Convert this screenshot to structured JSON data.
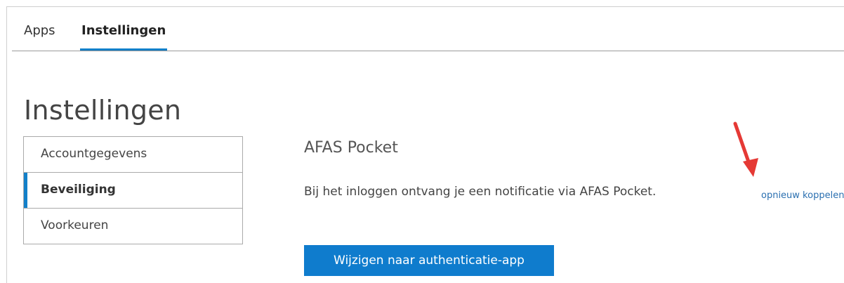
{
  "tabs": [
    {
      "label": "Apps",
      "active": false
    },
    {
      "label": "Instellingen",
      "active": true
    }
  ],
  "page": {
    "title": "Instellingen"
  },
  "settings_menu": {
    "items": [
      {
        "label": "Accountgegevens",
        "active": false
      },
      {
        "label": "Beveiliging",
        "active": true
      },
      {
        "label": "Voorkeuren",
        "active": false
      }
    ]
  },
  "security": {
    "section_title": "AFAS Pocket",
    "description": "Bij het inloggen ontvang je een notificatie via AFAS Pocket.",
    "relink_label": "opnieuw koppelen",
    "change_button_label": "Wijzigen naar authenticatie-app"
  },
  "colors": {
    "accent": "#1380c9",
    "button": "#0f7ccd",
    "annotation_arrow": "#e53935"
  },
  "icons": {
    "annotation": "red-arrow-icon"
  }
}
